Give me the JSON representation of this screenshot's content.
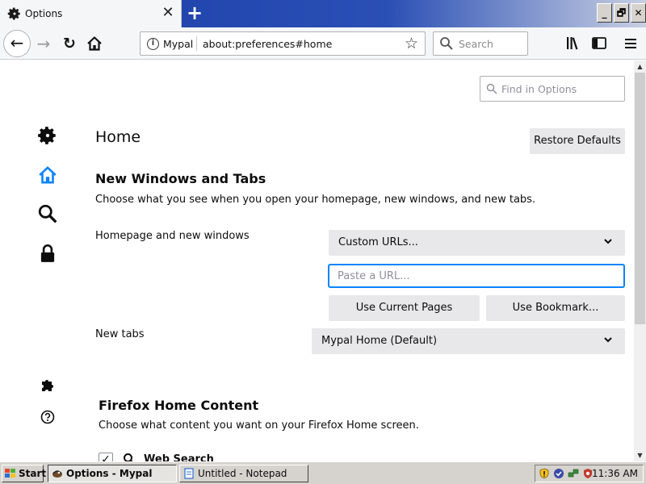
{
  "tab": {
    "title": "Options",
    "icon": "gear-icon",
    "close_glyph": "✕",
    "new_tab_glyph": "+"
  },
  "window_buttons": [
    "_",
    "🗗",
    "✕"
  ],
  "nav": {
    "back_glyph": "←",
    "forward_glyph": "→",
    "reload_glyph": "↻"
  },
  "urlbar": {
    "site_name": "Mypal",
    "url": "about:preferences#home",
    "info_glyph": "i",
    "star_glyph": "☆"
  },
  "searchbar": {
    "placeholder": "Search"
  },
  "find": {
    "placeholder": "Find in Options"
  },
  "sidebar": {
    "items": [
      {
        "name": "general",
        "icon": "gear-icon"
      },
      {
        "name": "home",
        "icon": "home-icon",
        "selected": true
      },
      {
        "name": "search",
        "icon": "search-icon"
      },
      {
        "name": "privacy",
        "icon": "lock-icon"
      },
      {
        "name": "extensions",
        "icon": "puzzle-icon"
      },
      {
        "name": "support",
        "icon": "help-icon"
      }
    ]
  },
  "page": {
    "title": "Home",
    "restore_label": "Restore Defaults"
  },
  "new_windows": {
    "heading": "New Windows and Tabs",
    "description": "Choose what you see when you open your homepage, new windows, and new tabs.",
    "homepage_label": "Homepage and new windows",
    "homepage_select": "Custom URLs...",
    "url_placeholder": "Paste a URL...",
    "use_current_label": "Use Current Pages",
    "use_bookmark_label": "Use Bookmark...",
    "newtabs_label": "New tabs",
    "newtabs_select": "Mypal Home (Default)"
  },
  "home_content": {
    "heading": "Firefox Home Content",
    "description": "Choose what content you want on your Firefox Home screen.",
    "web_search_label": "Web Search",
    "web_search_checked": true,
    "check_glyph": "✓"
  },
  "taskbar": {
    "start_label": "Start",
    "tasks": [
      {
        "label": "Options - Mypal",
        "active": true
      },
      {
        "label": "Untitled - Notepad",
        "active": false
      }
    ],
    "clock": "11:36 AM"
  },
  "colors": {
    "accent": "#0a84ff",
    "home_icon": "#0a84ff",
    "button_bg": "#e8e8ea"
  }
}
